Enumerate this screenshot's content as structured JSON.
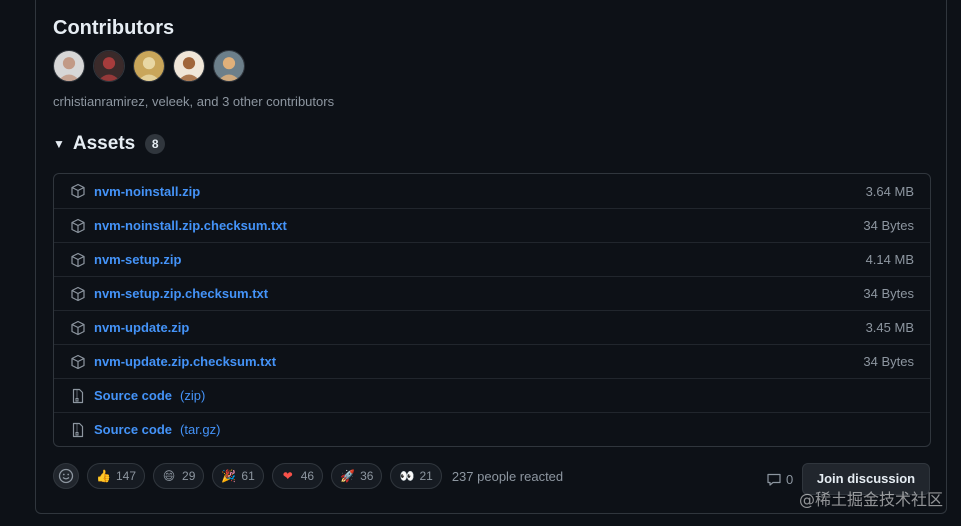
{
  "contributors": {
    "heading": "Contributors",
    "summary": "crhistianramirez, veleek, and 3 other contributors",
    "avatars": [
      {
        "name": "avatar-1",
        "bg": "#d7d7d7",
        "fg": "#c29a86"
      },
      {
        "name": "avatar-2",
        "bg": "#3a2a2a",
        "fg": "#a63c3c"
      },
      {
        "name": "avatar-3",
        "bg": "#c9a65a",
        "fg": "#e8d7a3"
      },
      {
        "name": "avatar-4",
        "bg": "#f0e6d8",
        "fg": "#a0653a"
      },
      {
        "name": "avatar-5",
        "bg": "#6c7f8a",
        "fg": "#e0b07a"
      }
    ]
  },
  "assets": {
    "title": "Assets",
    "count": "8",
    "items": [
      {
        "name": "nvm-noinstall.zip",
        "size": "3.64 MB",
        "icon": "package-icon"
      },
      {
        "name": "nvm-noinstall.zip.checksum.txt",
        "size": "34 Bytes",
        "icon": "package-icon"
      },
      {
        "name": "nvm-setup.zip",
        "size": "4.14 MB",
        "icon": "package-icon"
      },
      {
        "name": "nvm-setup.zip.checksum.txt",
        "size": "34 Bytes",
        "icon": "package-icon"
      },
      {
        "name": "nvm-update.zip",
        "size": "3.45 MB",
        "icon": "package-icon"
      },
      {
        "name": "nvm-update.zip.checksum.txt",
        "size": "34 Bytes",
        "icon": "package-icon"
      },
      {
        "name": "Source code",
        "suffix": "(zip)",
        "icon": "file-zip-icon"
      },
      {
        "name": "Source code",
        "suffix": "(tar.gz)",
        "icon": "file-zip-icon"
      }
    ]
  },
  "reactions": {
    "items": [
      {
        "emoji": "👍",
        "count": "147",
        "icon": "thumbs-up-icon"
      },
      {
        "emoji": "😄",
        "count": "29",
        "icon": "smile-icon"
      },
      {
        "emoji": "🎉",
        "count": "61",
        "icon": "tada-icon"
      },
      {
        "emoji": "❤",
        "count": "46",
        "icon": "heart-icon"
      },
      {
        "emoji": "🚀",
        "count": "36",
        "icon": "rocket-icon"
      },
      {
        "emoji": "👀",
        "count": "21",
        "icon": "eyes-icon"
      }
    ],
    "summary": "237 people reacted"
  },
  "discussion": {
    "comment_count": "0",
    "join_label": "Join discussion"
  },
  "watermark": "@稀土掘金技术社区",
  "colors": {
    "link": "#4493f8",
    "muted": "#8d96a0",
    "border": "#30363d",
    "background": "#0d1117"
  }
}
